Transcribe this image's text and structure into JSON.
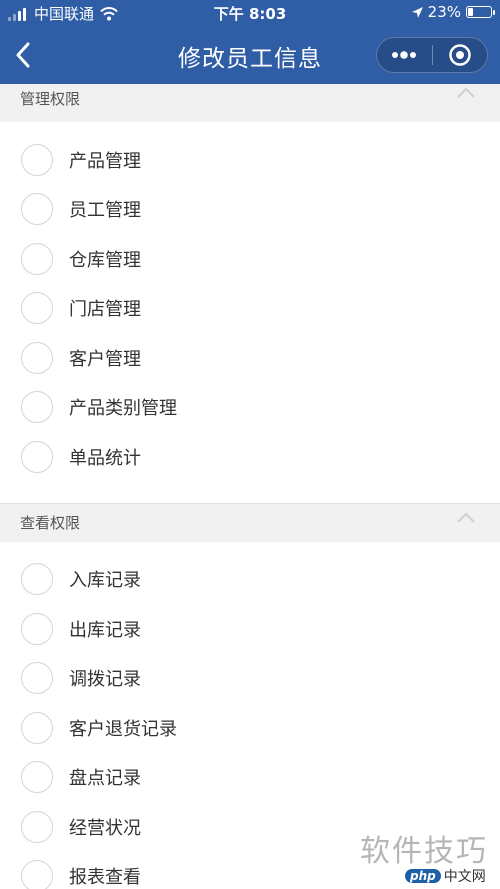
{
  "status_bar": {
    "carrier": "中国联通",
    "time": "下午 8:03",
    "battery_text": "23%",
    "battery_level": 0.23,
    "icons": [
      "signal-icon",
      "wifi-icon",
      "location-arrow-icon",
      "battery-icon"
    ]
  },
  "nav": {
    "title": "修改员工信息",
    "icons": [
      "chevron-left-icon",
      "more-dots-icon",
      "close-target-icon"
    ]
  },
  "sections": [
    {
      "title": "管理权限",
      "items": [
        "产品管理",
        "员工管理",
        "仓库管理",
        "门店管理",
        "客户管理",
        "产品类别管理",
        "单品统计"
      ]
    },
    {
      "title": "查看权限",
      "items": [
        "入库记录",
        "出库记录",
        "调拨记录",
        "客户退货记录",
        "盘点记录",
        "经营状况",
        "报表查看"
      ]
    }
  ],
  "watermark": {
    "text": "软件技巧",
    "logo_text": "php",
    "logo_suffix": "中文网"
  },
  "colors": {
    "nav_bg": "#2f5ea6",
    "section_bg": "#f1f1f1",
    "radio_border": "#d4d4d4"
  }
}
